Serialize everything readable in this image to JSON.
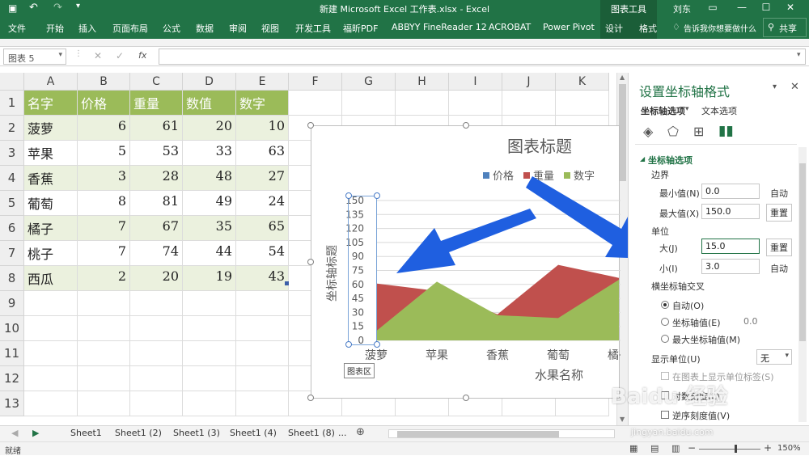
{
  "app": {
    "doc_title": "新建 Microsoft Excel 工作表.xlsx  -  Excel",
    "tool_label": "图表工具",
    "user": "刘东",
    "tabs": [
      "文件",
      "开始",
      "插入",
      "页面布局",
      "公式",
      "数据",
      "审阅",
      "视图",
      "开发工具",
      "福昕PDF",
      "ABBYY FineReader 12",
      "ACROBAT",
      "Power Pivot",
      "设计",
      "格式"
    ],
    "tell_me": "告诉我你想要做什么",
    "share": "共享"
  },
  "formula_bar": {
    "name_box": "图表 5",
    "fx": "fx",
    "content": ""
  },
  "grid": {
    "columns": [
      "A",
      "B",
      "C",
      "D",
      "E",
      "F",
      "G",
      "H",
      "I",
      "J",
      "K"
    ],
    "rows": [
      "1",
      "2",
      "3",
      "4",
      "5",
      "6",
      "7",
      "8",
      "9",
      "10",
      "11",
      "12",
      "13"
    ],
    "header": [
      "名字",
      "价格",
      "重量",
      "数值",
      "数字"
    ],
    "data": [
      [
        "菠萝",
        "6",
        "61",
        "20",
        "10"
      ],
      [
        "苹果",
        "5",
        "53",
        "33",
        "63"
      ],
      [
        "香蕉",
        "3",
        "28",
        "48",
        "27"
      ],
      [
        "葡萄",
        "8",
        "81",
        "49",
        "24"
      ],
      [
        "橘子",
        "7",
        "67",
        "35",
        "65"
      ],
      [
        "桃子",
        "7",
        "74",
        "44",
        "54"
      ],
      [
        "西瓜",
        "2",
        "20",
        "19",
        "43"
      ]
    ]
  },
  "chart_data": {
    "type": "area",
    "title": "图表标题",
    "ylabel": "坐标轴标题",
    "xlabel": "水果名称",
    "categories": [
      "菠萝",
      "苹果",
      "香蕉",
      "葡萄",
      "橘子"
    ],
    "series": [
      {
        "name": "价格",
        "values": [
          6,
          5,
          3,
          8,
          7
        ],
        "color": "#4f81bd"
      },
      {
        "name": "重量",
        "values": [
          61,
          53,
          28,
          81,
          67
        ],
        "color": "#c0504d"
      },
      {
        "name": "数字",
        "values": [
          10,
          63,
          27,
          24,
          65
        ],
        "color": "#9bbb59"
      }
    ],
    "ylim": [
      0,
      150
    ],
    "yticks": [
      "150",
      "135",
      "120",
      "105",
      "90",
      "75",
      "60",
      "45",
      "30",
      "15",
      "0"
    ],
    "legend_position": "top",
    "plot_area_tooltip": "图表区"
  },
  "panel": {
    "title": "设置坐标轴格式",
    "tab_axis_options": "坐标轴选项",
    "tab_text_options": "文本选项",
    "section": "坐标轴选项",
    "bounds_label": "边界",
    "min_label": "最小值(N)",
    "min_value": "0.0",
    "min_btn": "自动",
    "max_label": "最大值(X)",
    "max_value": "150.0",
    "max_btn": "重置",
    "units_label": "单位",
    "major_label": "大(J)",
    "major_value": "15.0",
    "major_btn": "重置",
    "minor_label": "小(I)",
    "minor_value": "3.0",
    "minor_btn": "自动",
    "cross_label": "横坐标轴交叉",
    "cross_auto": "自动(O)",
    "cross_value_label": "坐标轴值(E)",
    "cross_value": "0.0",
    "cross_max": "最大坐标轴值(M)",
    "display_units_label": "显示单位(U)",
    "display_units_value": "无",
    "show_units_label": "在图表上显示单位标签(S)",
    "log_scale_label": "对数刻度(L)",
    "reverse_label": "逆序刻度值(V)"
  },
  "sheets": [
    "Sheet1",
    "Sheet1 (2)",
    "Sheet1 (3)",
    "Sheet1 (4)",
    "Sheet1 (8)",
    "..."
  ],
  "status": {
    "ready": "就绪",
    "zoom": "150%"
  },
  "watermark": {
    "text": "Baidu 经验",
    "url": "jingyan.baidu.com"
  },
  "colors": {
    "excel_green": "#217346",
    "header_fill": "#9bbb59",
    "band_fill": "#ebf1de",
    "arrow_blue": "#1f5fe0"
  }
}
